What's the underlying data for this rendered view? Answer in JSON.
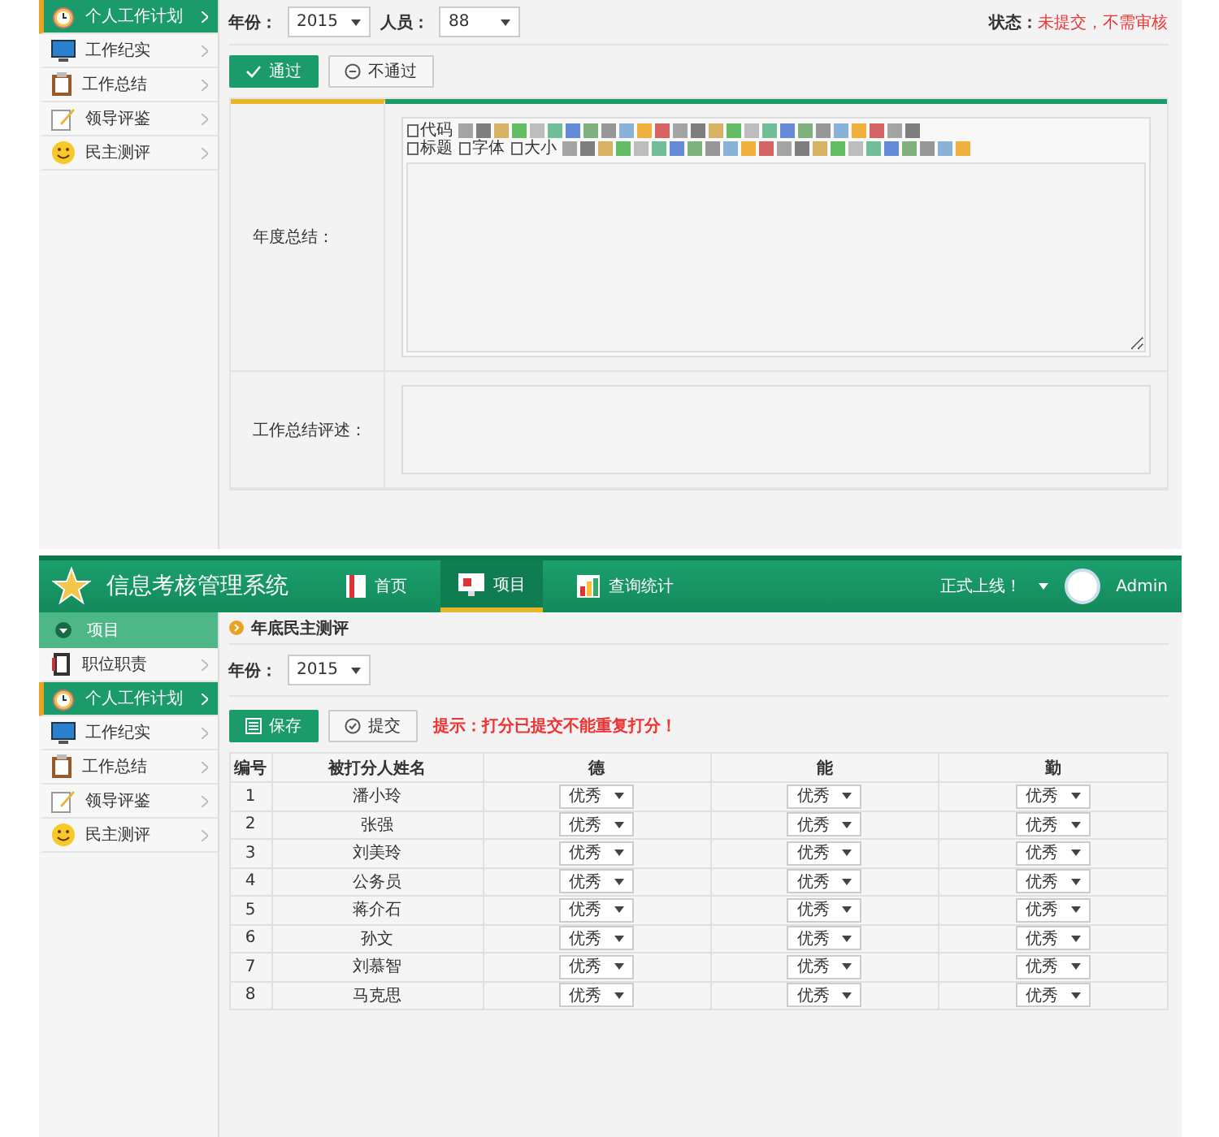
{
  "top_screen": {
    "sidebar": {
      "items": [
        {
          "label": "个人工作计划",
          "selected": true
        },
        {
          "label": "工作纪实",
          "selected": false
        },
        {
          "label": "工作总结",
          "selected": false
        },
        {
          "label": "领导评鉴",
          "selected": false
        },
        {
          "label": "民主测评",
          "selected": false
        }
      ]
    },
    "filters": [
      {
        "label": "年份：",
        "value": "2015"
      },
      {
        "label": "人员：",
        "value": "88"
      }
    ],
    "status": {
      "label": "状态：",
      "value": "未提交，不需审核"
    },
    "buttons": [
      {
        "label": "通过",
        "kind": "primary"
      },
      {
        "label": "不通过",
        "kind": "secondary"
      }
    ],
    "form": {
      "rows": [
        {
          "label": "年度总结：",
          "kind": "editor"
        },
        {
          "label": "工作总结评述：",
          "kind": "textarea"
        }
      ],
      "editor_toolbar": [
        {
          "labels": [
            "代码"
          ]
        },
        {
          "labels": [
            "标题",
            "字体",
            "大小"
          ]
        }
      ]
    }
  },
  "bottom_screen": {
    "header": {
      "title": "信息考核管理系统",
      "nav": [
        {
          "label": "首页",
          "selected": false
        },
        {
          "label": "项目",
          "selected": true
        },
        {
          "label": "查询统计",
          "selected": false
        }
      ],
      "notice": "正式上线！",
      "user": "Admin"
    },
    "sidebar": {
      "section": "项目",
      "items": [
        {
          "label": "职位职责",
          "selected": false
        },
        {
          "label": "个人工作计划",
          "selected": true
        },
        {
          "label": "工作纪实",
          "selected": false
        },
        {
          "label": "工作总结",
          "selected": false
        },
        {
          "label": "领导评鉴",
          "selected": false
        },
        {
          "label": "民主测评",
          "selected": false
        }
      ]
    },
    "breadcrumb": "年底民主测评",
    "filters": [
      {
        "label": "年份：",
        "value": "2015"
      }
    ],
    "buttons": [
      {
        "label": "保存",
        "kind": "primary"
      },
      {
        "label": "提交",
        "kind": "secondary"
      }
    ],
    "tip": "提示：打分已提交不能重复打分！",
    "table": {
      "columns": [
        "编号",
        "被打分人姓名",
        "德",
        "能",
        "勤"
      ],
      "rows": [
        {
          "number": "1",
          "name": "潘小玲",
          "scores": [
            "优秀",
            "优秀",
            "优秀"
          ]
        },
        {
          "number": "2",
          "name": "张强",
          "scores": [
            "优秀",
            "优秀",
            "优秀"
          ]
        },
        {
          "number": "3",
          "name": "刘美玲",
          "scores": [
            "优秀",
            "优秀",
            "优秀"
          ]
        },
        {
          "number": "4",
          "name": "公务员",
          "scores": [
            "优秀",
            "优秀",
            "优秀"
          ]
        },
        {
          "number": "5",
          "name": "蒋介石",
          "scores": [
            "优秀",
            "优秀",
            "优秀"
          ]
        },
        {
          "number": "6",
          "name": "孙文",
          "scores": [
            "优秀",
            "优秀",
            "优秀"
          ]
        },
        {
          "number": "7",
          "name": "刘慕智",
          "scores": [
            "优秀",
            "优秀",
            "优秀"
          ]
        },
        {
          "number": "8",
          "name": "马克思",
          "scores": [
            "优秀",
            "优秀",
            "优秀"
          ]
        }
      ]
    }
  }
}
